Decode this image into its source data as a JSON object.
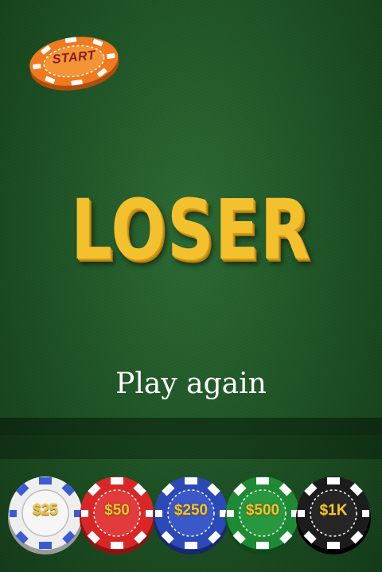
{
  "start_chip": {
    "label": "START",
    "color": "#f07a1d"
  },
  "result": {
    "title": "LOSER"
  },
  "actions": {
    "play_again": "Play again"
  },
  "chips": [
    {
      "label": "$25",
      "color": "#eeeeee",
      "stripe": "#3b5ad6"
    },
    {
      "label": "$50",
      "color": "#d92626",
      "stripe": "#ffffff"
    },
    {
      "label": "$250",
      "color": "#2c49b8",
      "stripe": "#ffffff"
    },
    {
      "label": "$500",
      "color": "#1f8a34",
      "stripe": "#ffffff"
    },
    {
      "label": "$1K",
      "color": "#1c1c1c",
      "stripe": "#ffffff"
    }
  ]
}
